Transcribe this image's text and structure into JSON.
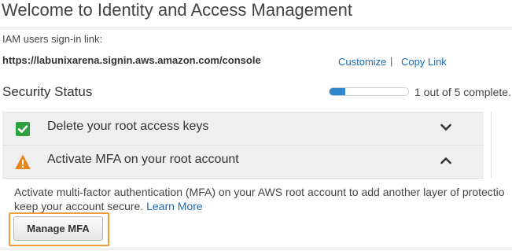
{
  "header": {
    "title": "Welcome to Identity and Access Management"
  },
  "signin": {
    "label": "IAM users sign-in link:",
    "url": "https://labunixarena.signin.aws.amazon.com/console",
    "customize_label": "Customize",
    "separator": "|",
    "copy_link_label": "Copy Link"
  },
  "security": {
    "title": "Security Status",
    "progress": {
      "completed": 1,
      "total": 5,
      "text": "1 out of 5 complete."
    },
    "items": [
      {
        "label": "Delete your root access keys",
        "status": "complete",
        "status_icon": "check-icon",
        "expanded": false,
        "chevron": "chevron-down-icon"
      },
      {
        "label": "Activate MFA on your root account",
        "status": "warning",
        "status_icon": "warning-icon",
        "expanded": true,
        "chevron": "chevron-up-icon"
      }
    ],
    "mfa_detail": {
      "line1": "Activate multi-factor authentication (MFA) on your AWS root account to add another layer of protectio",
      "line2": "keep your account secure.",
      "learn_more": "Learn More",
      "button_label": "Manage MFA"
    }
  },
  "colors": {
    "link": "#1a6bb5",
    "progress_fill": "#2e86c8",
    "success": "#2da140",
    "warning": "#e8861d",
    "highlight": "#f39a3b"
  }
}
